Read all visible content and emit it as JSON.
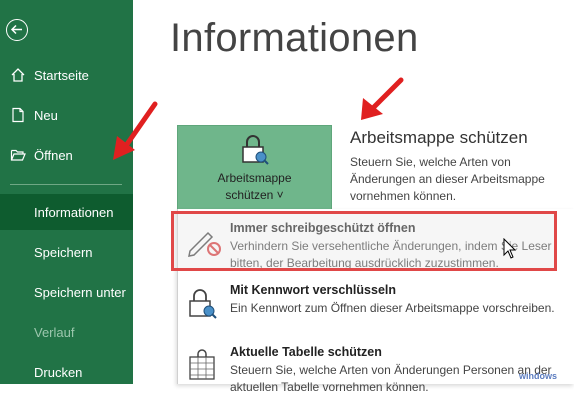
{
  "sidebar": {
    "items": [
      {
        "label": "Startseite",
        "icon": "home-icon"
      },
      {
        "label": "Neu",
        "icon": "new-file-icon"
      },
      {
        "label": "Öffnen",
        "icon": "folder-open-icon"
      },
      {
        "label": "Informationen",
        "active": true
      },
      {
        "label": "Speichern"
      },
      {
        "label": "Speichern unter"
      },
      {
        "label": "Verlauf",
        "disabled": true
      },
      {
        "label": "Drucken"
      }
    ],
    "accent": "#217346"
  },
  "main": {
    "title": "Informationen",
    "protect_button": {
      "line1": "Arbeitsmappe",
      "line2": "schützen ˅"
    },
    "section_title": "Arbeitsmappe schützen",
    "section_desc": "Steuern Sie, welche Arten von Änderungen an dieser Arbeitsmappe vornehmen können."
  },
  "menu": {
    "items": [
      {
        "title": "Immer schreibgeschützt öffnen",
        "desc": "Verhindern Sie versehentliche Änderungen, indem Sie Leser bitten, der Bearbeitung ausdrücklich zuzustimmen.",
        "icon": "pencil-no-edit-icon"
      },
      {
        "title": "Mit Kennwort verschlüsseln",
        "desc": "Ein Kennwort zum Öffnen dieser Arbeitsmappe vorschreiben.",
        "icon": "lock-key-icon"
      },
      {
        "title": "Aktuelle Tabelle schützen",
        "desc": "Steuern Sie, welche Arten von Änderungen Personen an der aktuellen Tabelle vornehmen können.",
        "icon": "sheet-lock-icon"
      }
    ]
  },
  "watermark": "windows"
}
